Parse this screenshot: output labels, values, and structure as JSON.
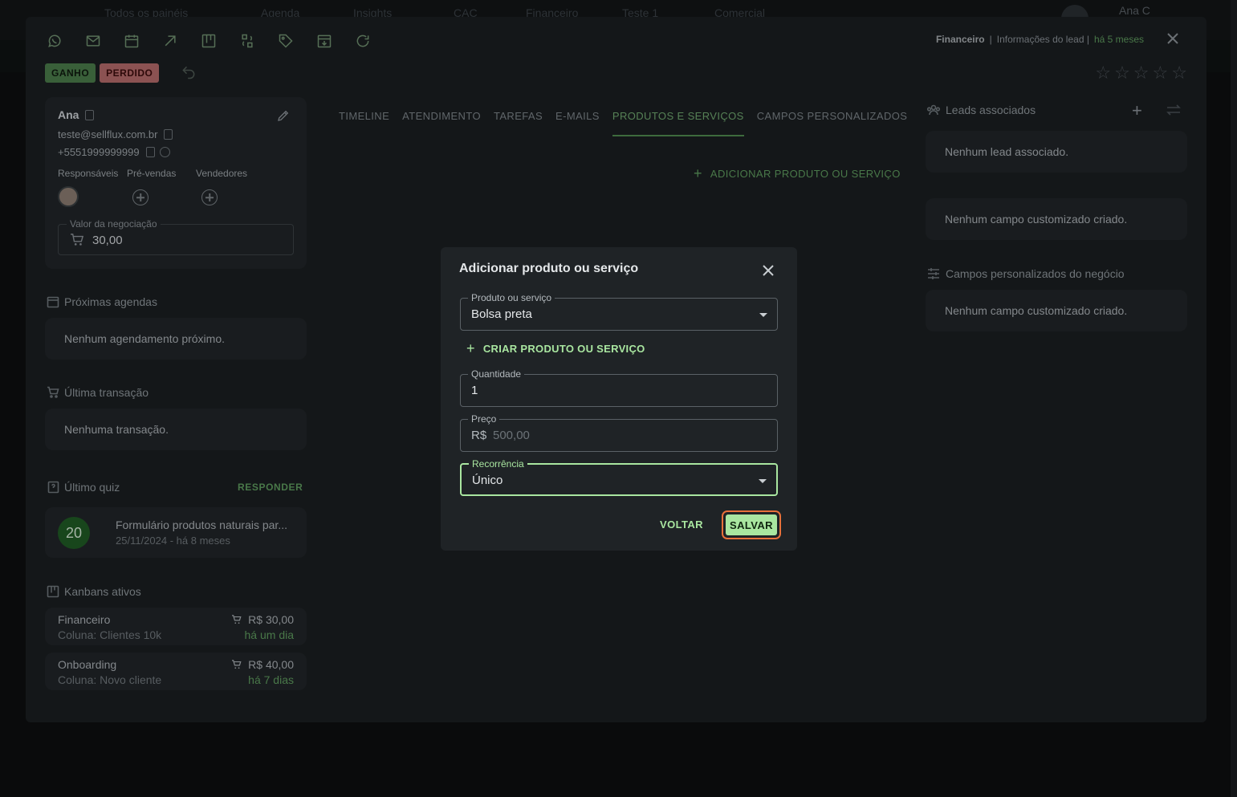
{
  "background": {
    "nav_items": [
      "Todos os painéis",
      "Agenda",
      "Insights",
      "CAC",
      "Financeiro",
      "Teste 1",
      "Comercial"
    ],
    "user_name": "Ana C"
  },
  "header": {
    "breadcrumb_pipeline": "Financeiro",
    "breadcrumb_separator": "|",
    "breadcrumb_page": "Informações do lead |",
    "breadcrumb_time": "há 5 meses"
  },
  "toolbar": {
    "icons": [
      "whatsapp-icon",
      "mail-icon",
      "calendar-icon",
      "arrow-up-right-icon",
      "kanban-icon",
      "transfer-icon",
      "tag-icon",
      "archive-icon",
      "refresh-icon"
    ]
  },
  "status": {
    "won_label": "GANHO",
    "lost_label": "PERDIDO"
  },
  "rating": {
    "value": 0,
    "max": 5
  },
  "contact": {
    "name": "Ana",
    "email": "teste@sellflux.com.br",
    "phone": "+5551999999999",
    "roles": {
      "responsaveis": "Responsáveis",
      "prevendas": "Pré-vendas",
      "vendedores": "Vendedores"
    },
    "deal_value_label": "Valor da negociação",
    "deal_value": "30,00"
  },
  "sections": {
    "agendas_title": "Próximas agendas",
    "agendas_empty": "Nenhum agendamento próximo.",
    "transaction_title": "Última transação",
    "transaction_empty": "Nenhuma transação.",
    "quiz_title": "Último quiz",
    "quiz_action": "RESPONDER",
    "quiz": {
      "score": "20",
      "name": "Formulário produtos naturais par...",
      "date": "25/11/2024 - há 8 meses"
    },
    "kanbans_title": "Kanbans ativos",
    "kanbans": [
      {
        "name": "Financeiro",
        "column": "Coluna: Clientes 10k",
        "value": "R$ 30,00",
        "time": "há um dia"
      },
      {
        "name": "Onboarding",
        "column": "Coluna: Novo cliente",
        "value": "R$ 40,00",
        "time": "há 7 dias"
      }
    ]
  },
  "tabs": [
    {
      "label": "TIMELINE"
    },
    {
      "label": "ATENDIMENTO"
    },
    {
      "label": "TAREFAS"
    },
    {
      "label": "E-MAILS"
    },
    {
      "label": "PRODUTOS E SERVIÇOS"
    },
    {
      "label": "CAMPOS PERSONALIZADOS"
    }
  ],
  "products": {
    "add_label": "ADICIONAR PRODUTO OU SERVIÇO"
  },
  "right": {
    "associated_title": "Leads associados",
    "associated_empty": "Nenhum lead associado.",
    "custom_empty": "Nenhum campo customizado criado.",
    "deal_fields_title": "Campos personalizados do negócio",
    "deal_fields_empty": "Nenhum campo customizado criado."
  },
  "modal": {
    "title": "Adicionar produto ou serviço",
    "product_label": "Produto ou serviço",
    "product_value": "Bolsa preta",
    "create_label": "CRIAR PRODUTO OU SERVIÇO",
    "quantity_label": "Quantidade",
    "quantity_value": "1",
    "price_label": "Preço",
    "price_prefix": "R$",
    "price_placeholder": "500,00",
    "recurrence_label": "Recorrência",
    "recurrence_value": "Único",
    "back_label": "VOLTAR",
    "save_label": "SALVAR"
  },
  "colors": {
    "accent": "#a9e6a0",
    "won": "#4a7a4a",
    "lost": "#b36a6a",
    "focus_ring": "#e8703a"
  }
}
